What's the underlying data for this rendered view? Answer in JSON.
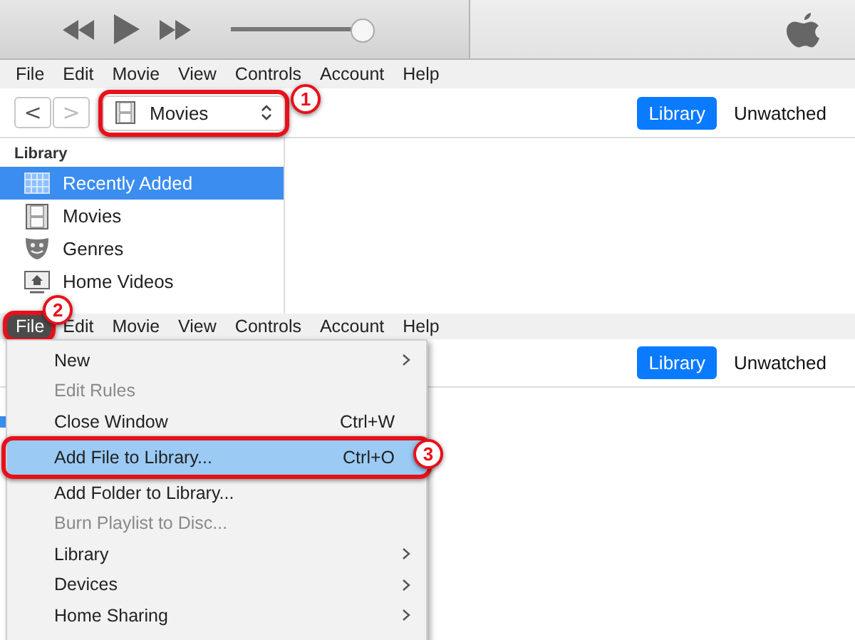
{
  "player": {
    "volume": {
      "level": 0.96
    }
  },
  "top": {
    "menubar": [
      {
        "label": "File",
        "selected": false
      },
      {
        "label": "Edit",
        "selected": false
      },
      {
        "label": "Movie",
        "selected": false
      },
      {
        "label": "View",
        "selected": false
      },
      {
        "label": "Controls",
        "selected": false
      },
      {
        "label": "Account",
        "selected": false
      },
      {
        "label": "Help",
        "selected": false
      }
    ],
    "nav": {
      "back": {
        "label": "<",
        "disabled": false
      },
      "forward": {
        "label": ">",
        "disabled": true
      },
      "media_picker": {
        "label": "Movies",
        "callout": "1"
      },
      "view_tabs": [
        {
          "label": "Library",
          "selected": true
        },
        {
          "label": "Unwatched",
          "selected": false
        }
      ]
    },
    "sidebar": {
      "heading": "Library",
      "items": [
        {
          "label": "Recently Added",
          "kind": "recent",
          "selected": true
        },
        {
          "label": "Movies",
          "kind": "movies",
          "selected": false
        },
        {
          "label": "Genres",
          "kind": "genres",
          "selected": false
        },
        {
          "label": "Home Videos",
          "kind": "home",
          "selected": false
        }
      ]
    }
  },
  "bottom": {
    "menubar": [
      {
        "label": "File",
        "selected": true,
        "callout": "2"
      },
      {
        "label": "Edit",
        "selected": false
      },
      {
        "label": "Movie",
        "selected": false
      },
      {
        "label": "View",
        "selected": false
      },
      {
        "label": "Controls",
        "selected": false
      },
      {
        "label": "Account",
        "selected": false
      },
      {
        "label": "Help",
        "selected": false
      }
    ],
    "view_tabs": [
      {
        "label": "Library",
        "selected": true
      },
      {
        "label": "Unwatched",
        "selected": false
      }
    ],
    "file_menu": [
      {
        "label": "New",
        "submenu": true,
        "disabled": false,
        "selected": false
      },
      {
        "label": "Edit Rules",
        "submenu": false,
        "disabled": true,
        "selected": false
      },
      {
        "label": "Close Window",
        "shortcut": "Ctrl+W",
        "submenu": false,
        "disabled": false,
        "selected": false
      },
      {
        "label": "Add File to Library...",
        "shortcut": "Ctrl+O",
        "submenu": false,
        "disabled": false,
        "selected": true,
        "callout": "3"
      },
      {
        "label": "Add Folder to Library...",
        "submenu": false,
        "disabled": false,
        "selected": false
      },
      {
        "label": "Burn Playlist to Disc...",
        "submenu": false,
        "disabled": true,
        "selected": false
      },
      {
        "label": "Library",
        "submenu": true,
        "disabled": false,
        "selected": false
      },
      {
        "label": "Devices",
        "submenu": true,
        "disabled": false,
        "selected": false
      },
      {
        "label": "Home Sharing",
        "submenu": true,
        "disabled": false,
        "selected": false
      }
    ]
  }
}
